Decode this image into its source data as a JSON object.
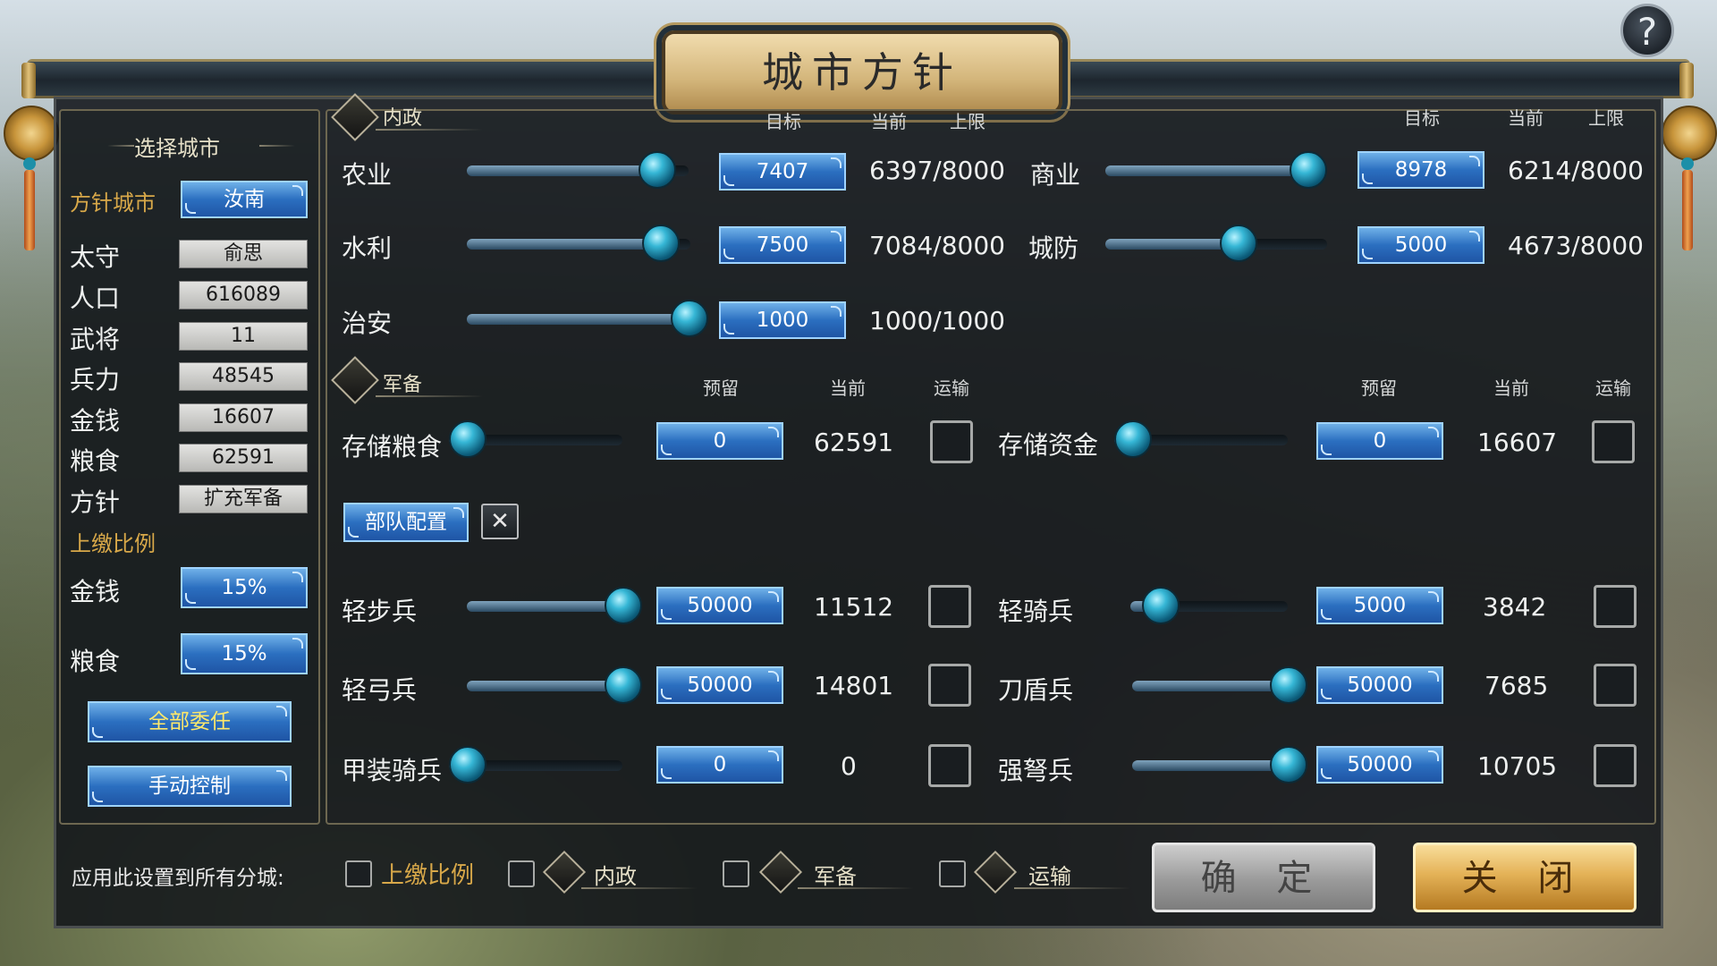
{
  "window_title": "城市方针",
  "help_label": "?",
  "left": {
    "section_title": "选择城市",
    "city_label": "方针城市",
    "city_value": "汝南",
    "info": [
      {
        "label": "太守",
        "value": "俞思"
      },
      {
        "label": "人口",
        "value": "616089"
      },
      {
        "label": "武将",
        "value": "11"
      },
      {
        "label": "兵力",
        "value": "48545"
      },
      {
        "label": "金钱",
        "value": "16607"
      },
      {
        "label": "粮食",
        "value": "62591"
      },
      {
        "label": "方针",
        "value": "扩充军备"
      }
    ],
    "tax_title": "上缴比例",
    "tax_money_label": "金钱",
    "tax_money_value": "15%",
    "tax_food_label": "粮食",
    "tax_food_value": "15%",
    "delegate_all_label": "全部委任",
    "manual_label": "手动控制"
  },
  "domestic": {
    "section_title": "内政",
    "headers_left": [
      "目标",
      "当前",
      "上限"
    ],
    "headers_right": [
      "目标",
      "当前",
      "上限"
    ],
    "rows": [
      {
        "label": "农业",
        "target": "7407",
        "current": "6397/8000",
        "level": 0.93
      },
      {
        "label": "水利",
        "target": "7500",
        "current": "7084/8000",
        "level": 0.94
      },
      {
        "label": "治安",
        "target": "1000",
        "current": "1000/1000",
        "level": 1.0
      },
      {
        "label": "商业",
        "target": "8978",
        "current": "6214/8000",
        "level": 1.0
      },
      {
        "label": "城防",
        "target": "5000",
        "current": "4673/8000",
        "level": 0.62
      }
    ]
  },
  "military": {
    "section_title": "军备",
    "headers_left": [
      "预留",
      "当前",
      "运输"
    ],
    "headers_right": [
      "预留",
      "当前",
      "运输"
    ],
    "storage": [
      {
        "label": "存储粮食",
        "reserve": "0",
        "current": "62591",
        "level": 0
      },
      {
        "label": "存储资金",
        "reserve": "0",
        "current": "16607",
        "level": 0
      }
    ],
    "troop_config_label": "部队配置",
    "troops": [
      {
        "label": "轻步兵",
        "target": "50000",
        "current": "11512",
        "level": 1.0
      },
      {
        "label": "轻弓兵",
        "target": "50000",
        "current": "14801",
        "level": 1.0
      },
      {
        "label": "甲装骑兵",
        "target": "0",
        "current": "0",
        "level": 0
      },
      {
        "label": "轻骑兵",
        "target": "5000",
        "current": "3842",
        "level": 0.1
      },
      {
        "label": "刀盾兵",
        "target": "50000",
        "current": "7685",
        "level": 1.0
      },
      {
        "label": "强弩兵",
        "target": "50000",
        "current": "10705",
        "level": 1.0
      }
    ]
  },
  "bottom": {
    "apply_label": "应用此设置到所有分城:",
    "options": [
      "上缴比例",
      "内政",
      "军备",
      "运输"
    ],
    "confirm_label": "确 定",
    "close_label": "关 闭"
  },
  "colors": {
    "accent_blue": "#2b6fc0",
    "gold": "#d8a849",
    "knob": "#36b7d6"
  }
}
